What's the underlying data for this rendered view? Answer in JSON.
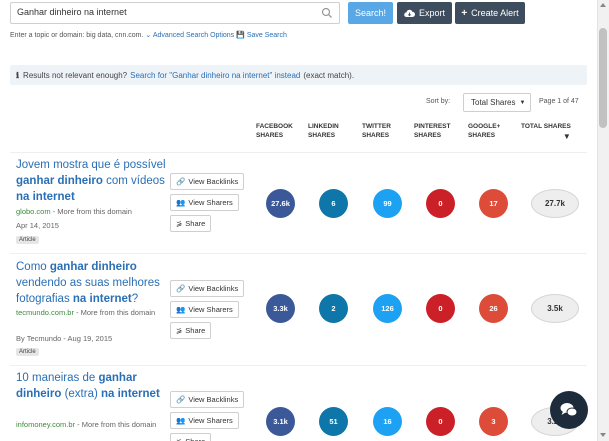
{
  "search": {
    "value": "Ganhar dinheiro na internet",
    "search_label": "Search!",
    "export_label": "Export",
    "alert_label": "Create Alert"
  },
  "hint": {
    "text": "Enter a topic or domain: big data, cnn.com.",
    "advanced_label": "Advanced Search Options",
    "save_label": "Save Search"
  },
  "info": {
    "prefix": "Results not relevant enough?",
    "link": "Search for \"Ganhar dinheiro na internet\" instead",
    "suffix": "(exact match)."
  },
  "sort": {
    "label": "Sort by:",
    "selected": "Total Shares",
    "page": "Page 1 of 47"
  },
  "columns": {
    "facebook": [
      "FACEBOOK",
      "SHARES"
    ],
    "linkedin": [
      "LINKEDIN",
      "SHARES"
    ],
    "twitter": [
      "TWITTER",
      "SHARES"
    ],
    "pinterest": [
      "PINTEREST",
      "SHARES"
    ],
    "google": [
      "GOOGLE+",
      "SHARES"
    ],
    "total": "TOTAL SHARES"
  },
  "actions": {
    "backlinks": "View Backlinks",
    "sharers": "View Sharers",
    "share": "Share"
  },
  "colors": {
    "facebook": "#3b5998",
    "linkedin": "#0e76a8",
    "twitter": "#1da1f2",
    "pinterest": "#cb2027",
    "google": "#dd4b39"
  },
  "articles": [
    {
      "title_parts": [
        "Jovem mostra que é possível ",
        "ganhar dinheiro",
        " com vídeos ",
        "na internet"
      ],
      "domain": "globo.com",
      "more": "More from this domain",
      "date": "Apr 14, 2015",
      "tag": "Article",
      "facebook": "27.6k",
      "linkedin": "6",
      "twitter": "99",
      "pinterest": "0",
      "google": "17",
      "total": "27.7k"
    },
    {
      "title_parts": [
        "Como ",
        "ganhar dinheiro",
        " vendendo as suas melhores fotografias ",
        "na internet",
        "?"
      ],
      "domain": "tecmundo.com.br",
      "more": "More from this domain",
      "date": "By Tecmundo - Aug 19, 2015",
      "tag": "Article",
      "facebook": "3.3k",
      "linkedin": "2",
      "twitter": "126",
      "pinterest": "0",
      "google": "26",
      "total": "3.5k"
    },
    {
      "title_parts": [
        "10 maneiras de ",
        "ganhar dinheiro",
        " (extra) ",
        "na internet"
      ],
      "domain": "infomoney.com.br",
      "more": "More from this domain",
      "facebook": "3.1k",
      "linkedin": "51",
      "twitter": "16",
      "pinterest": "0",
      "google": "3",
      "total": "3.2k"
    }
  ]
}
